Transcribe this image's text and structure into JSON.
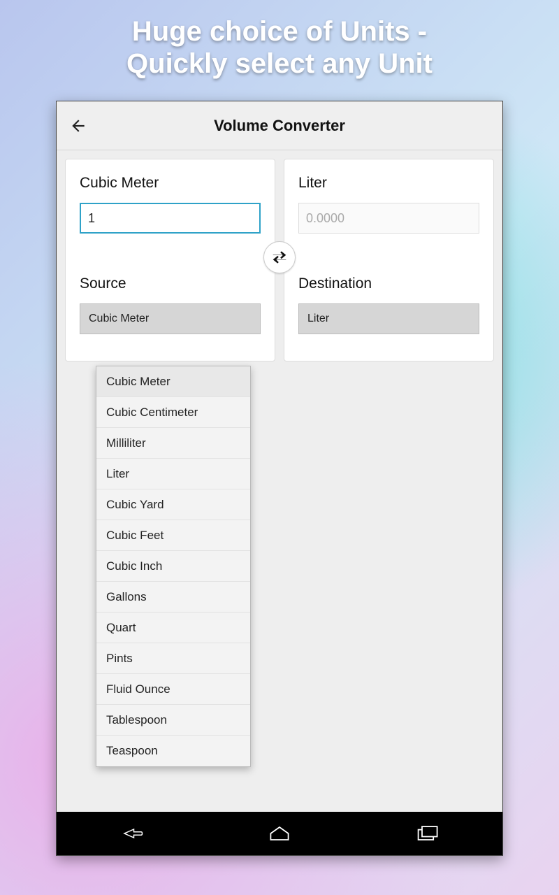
{
  "promo": {
    "line1": "Huge choice of Units -",
    "line2": "Quickly select any Unit"
  },
  "appbar": {
    "title": "Volume Converter"
  },
  "left": {
    "unit": "Cubic Meter",
    "value": "1",
    "section": "Source",
    "selected": "Cubic Meter"
  },
  "right": {
    "unit": "Liter",
    "value": "0.0000",
    "section": "Destination",
    "selected": "Liter"
  },
  "dropdown": {
    "items": [
      "Cubic Meter",
      "Cubic Centimeter",
      "Milliliter",
      "Liter",
      "Cubic Yard",
      "Cubic Feet",
      "Cubic Inch",
      "Gallons",
      "Quart",
      "Pints",
      "Fluid Ounce",
      "Tablespoon",
      "Teaspoon"
    ]
  }
}
